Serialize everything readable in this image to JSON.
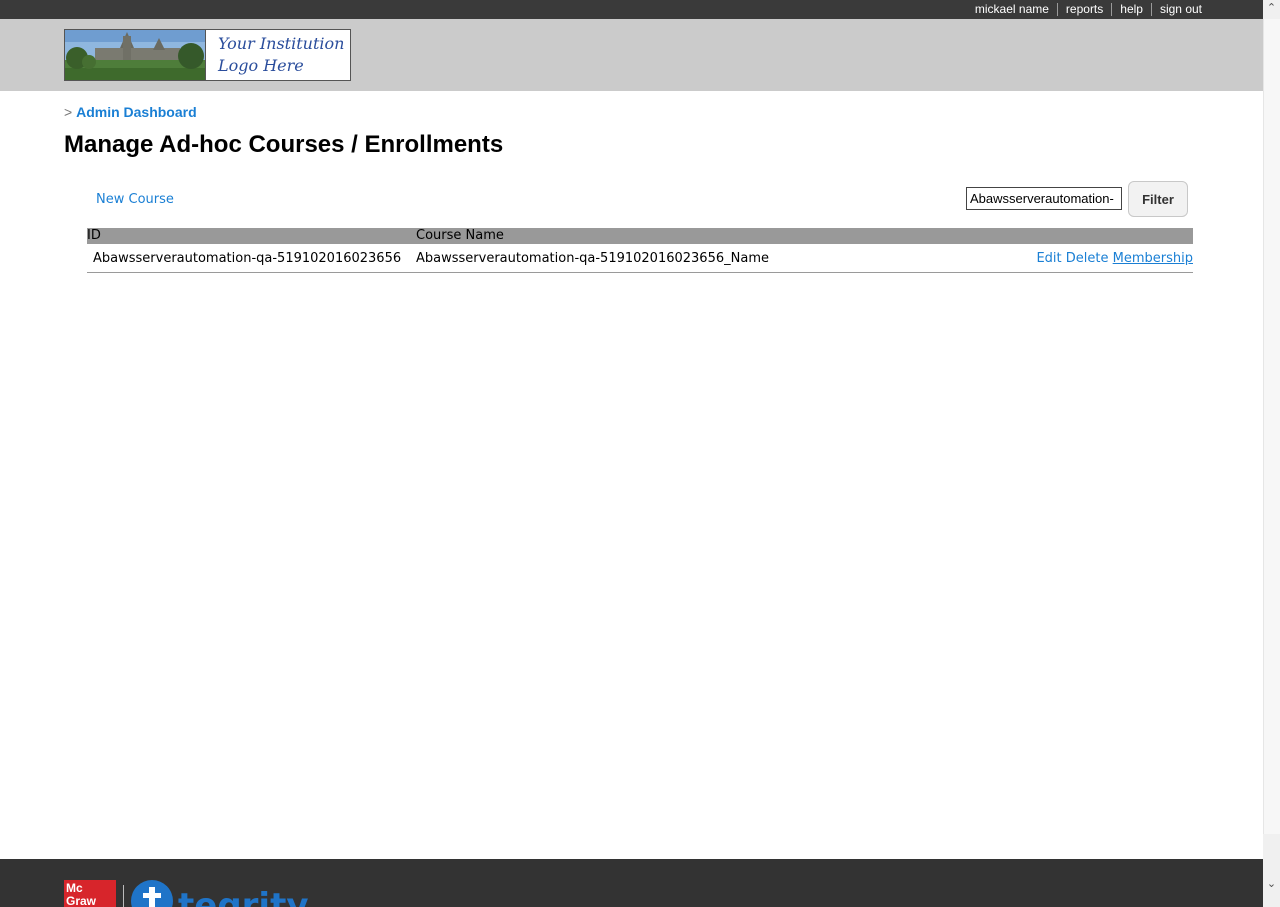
{
  "topnav": {
    "user": "mickael name",
    "reports": "reports",
    "help": "help",
    "signout": "sign out"
  },
  "logo": {
    "line1": "Your Institution",
    "line2": "Logo Here"
  },
  "breadcrumb": {
    "separator": ">",
    "link": "Admin Dashboard"
  },
  "page": {
    "title": "Manage Ad-hoc Courses / Enrollments"
  },
  "toolbar": {
    "new_course": "New Course",
    "filter_value": "Abawsserverautomation-",
    "filter_button": "Filter"
  },
  "table": {
    "headers": {
      "id": "ID",
      "name": "Course Name",
      "actions": ""
    },
    "rows": [
      {
        "id": "Abawsserverautomation-qa-519102016023656",
        "name": "Abawsserverautomation-qa-519102016023656_Name",
        "edit": "Edit",
        "delete": "Delete",
        "membership": "Membership"
      }
    ]
  },
  "footer": {
    "brand_line1": "Mc",
    "brand_line2": "Graw",
    "product": "tegrity"
  },
  "colors": {
    "link": "#1a7fd4",
    "topbar": "#3a3a3a",
    "header": "#cbcbcb",
    "table_header": "#999999",
    "footer": "#333333",
    "brand_red": "#d7252b"
  },
  "icons": {
    "scroll_up": "chevron-up-icon",
    "scroll_down": "chevron-down-icon"
  }
}
